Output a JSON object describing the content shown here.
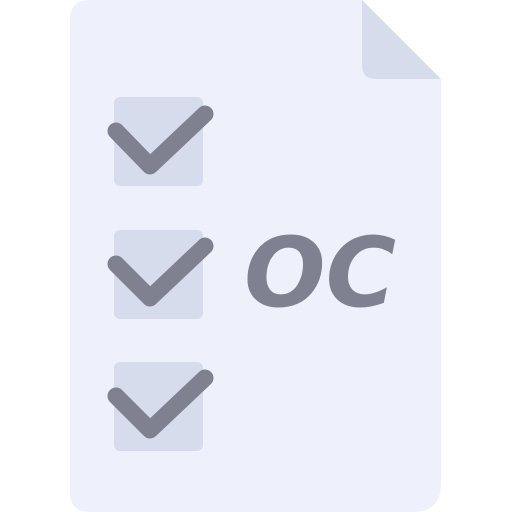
{
  "icon": {
    "name": "checklist-document-icon",
    "badge_text": "OC",
    "checked_item_count": 3
  },
  "colors": {
    "page": "#EEF1FB",
    "fold": "#D6DCEC",
    "checkbox": "#D6DCEC",
    "checkmark": "#7F8190",
    "badge_text": "#7F8190"
  }
}
